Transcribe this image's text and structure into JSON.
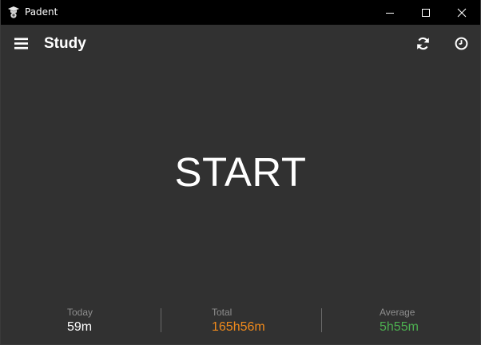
{
  "window": {
    "title": "Padent",
    "controls": [
      "minimize-icon",
      "maximize-icon",
      "close-icon"
    ]
  },
  "header": {
    "title": "Study",
    "icons": [
      "menu-icon",
      "refresh-icon",
      "clock-icon"
    ]
  },
  "main": {
    "start_label": "START"
  },
  "stats": {
    "today": {
      "label": "Today",
      "value": "59m",
      "color": "#ffffff"
    },
    "total": {
      "label": "Total",
      "value": "165h56m",
      "color": "#f08a1c"
    },
    "average": {
      "label": "Average",
      "value": "5h55m",
      "color": "#4caf50"
    }
  },
  "colors": {
    "titlebar": "#000000",
    "background": "#313131",
    "text": "#ffffff",
    "muted": "#8e8e8e"
  }
}
